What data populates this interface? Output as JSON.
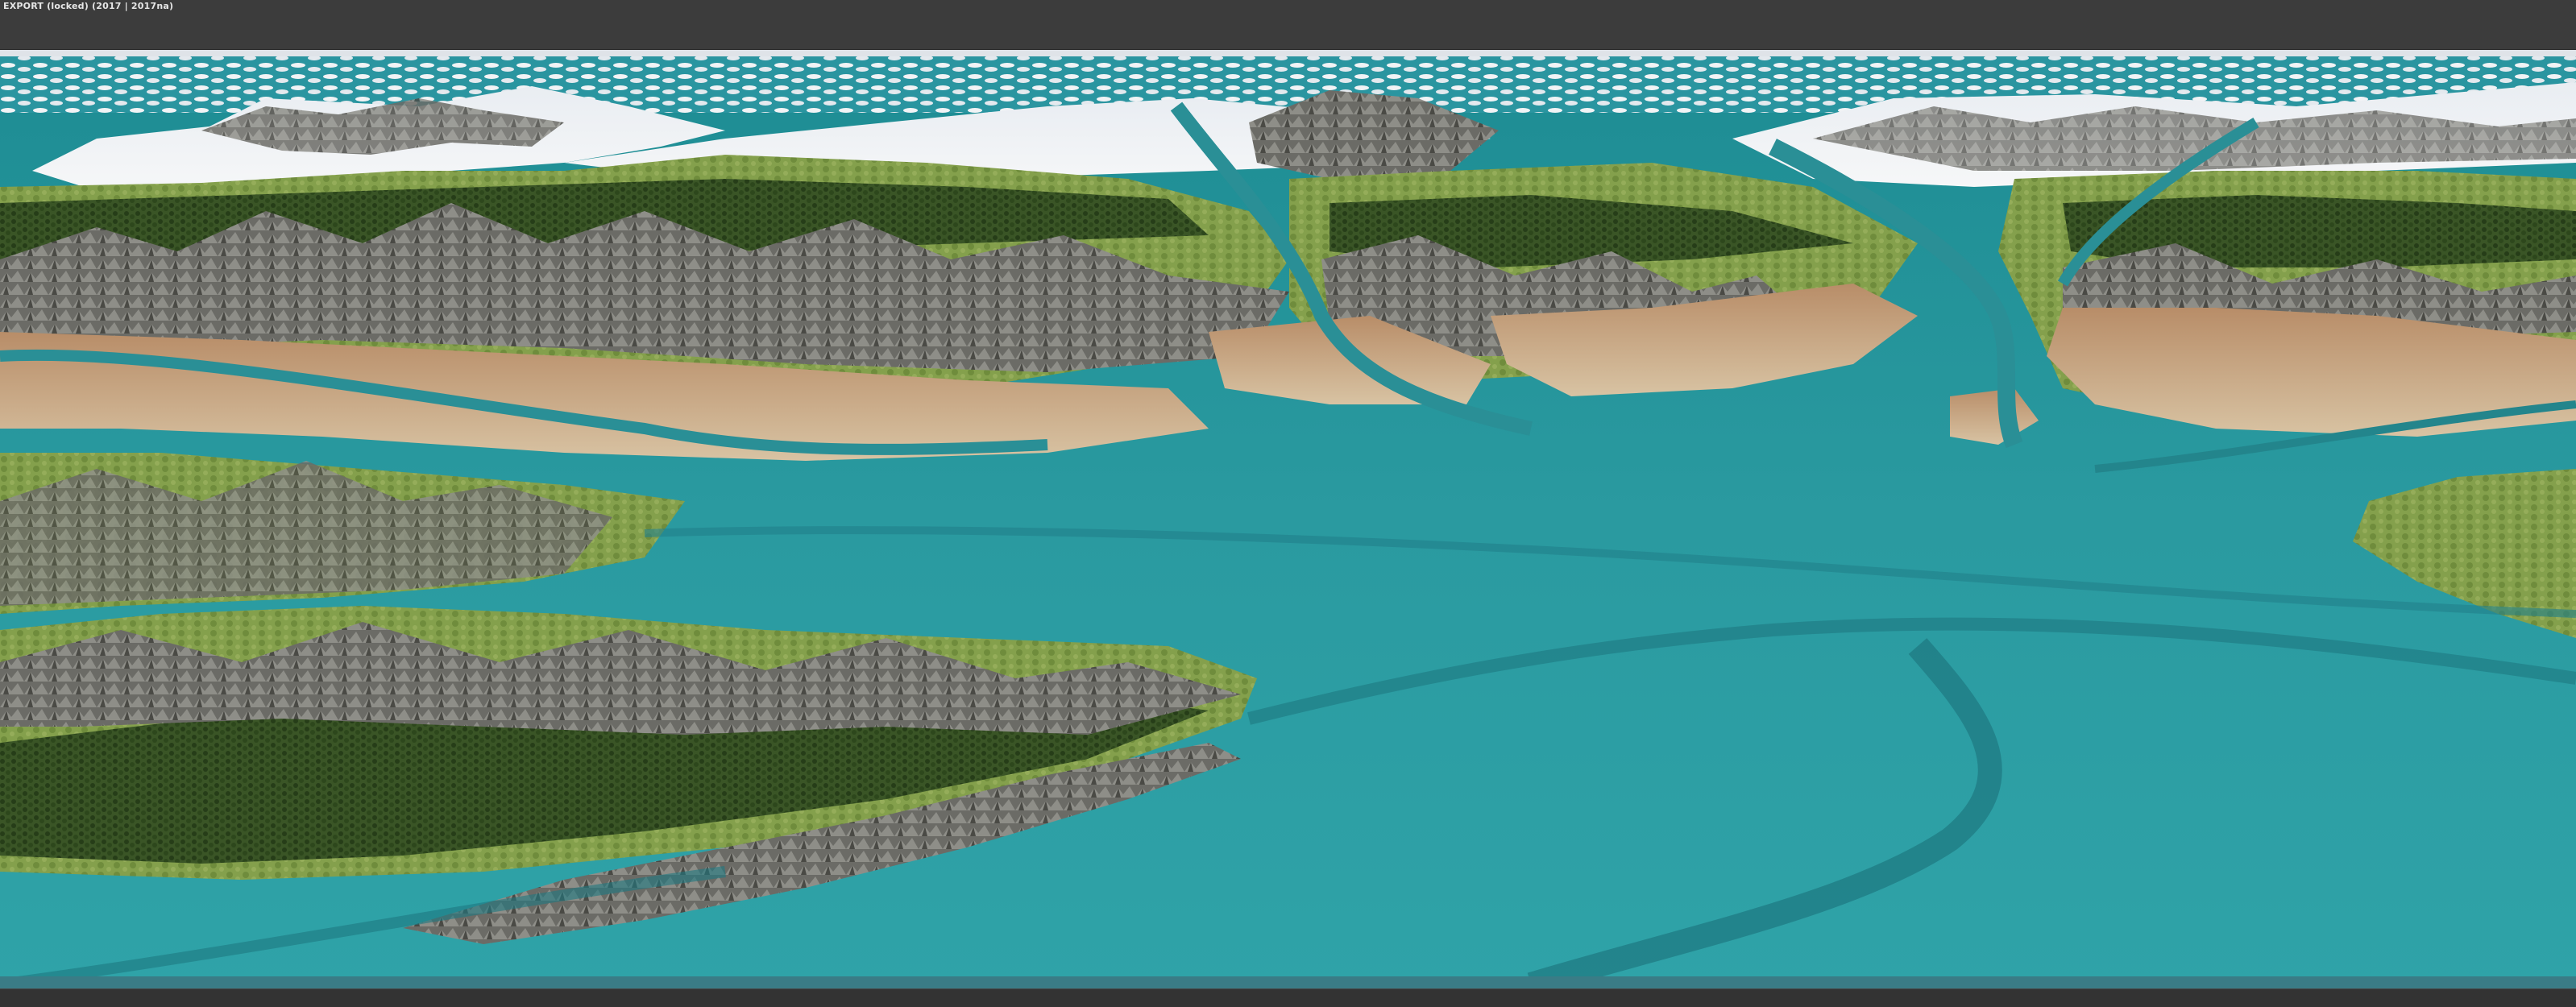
{
  "window": {
    "title": "EXPORT (locked) (2017 | 2017na)"
  },
  "viewport": {
    "scene": "3d-terrain-render",
    "colors": {
      "ocean": "#2f9aa0",
      "ocean_deep": "#1f7f86",
      "river": "#2a8f96",
      "snow": "#eef1f4",
      "rock": "#6f6f6a",
      "grass": "#7f9a48",
      "forest": "#2f4a1e",
      "desert": "#c9b08a",
      "sky_fade": "#dfe3e8"
    }
  }
}
